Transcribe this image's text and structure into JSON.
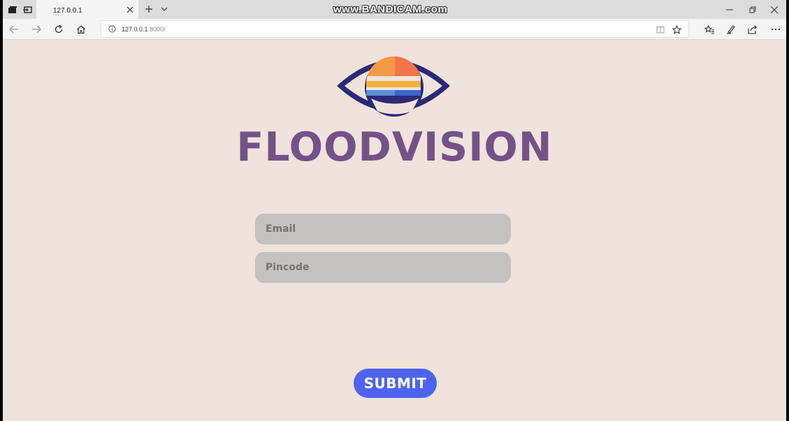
{
  "browser": {
    "tab": {
      "title": "127.0.0.1"
    },
    "watermark": "www.BANDICAM.com",
    "address": {
      "host": "127.0.0.1",
      "port_path": ":8000/"
    }
  },
  "page": {
    "brand": "FLOODVISION",
    "form": {
      "email_placeholder": "Email",
      "pincode_placeholder": "Pincode",
      "submit_label": "SUBMIT"
    }
  },
  "icons": {
    "tabstrip": [
      "tabs-aside-icon",
      "set-aside-icon"
    ],
    "tab": [
      "close-icon"
    ],
    "newtab": [
      "plus-icon",
      "chevron-down-icon"
    ],
    "window": [
      "minimize-icon",
      "restore-icon",
      "close-icon"
    ],
    "nav": [
      "back-arrow-icon",
      "forward-arrow-icon",
      "refresh-icon",
      "home-icon"
    ],
    "address": [
      "info-icon",
      "reading-view-icon",
      "star-icon"
    ],
    "toolbar": [
      "favorites-icon",
      "notes-icon",
      "share-icon",
      "more-icon"
    ]
  },
  "colors": {
    "page_background": "#efe3dc",
    "brand_text": "#745289",
    "input_background": "#c4c1c1",
    "submit_button": "#4f63f2",
    "logo_outline": "#2b2a78"
  }
}
